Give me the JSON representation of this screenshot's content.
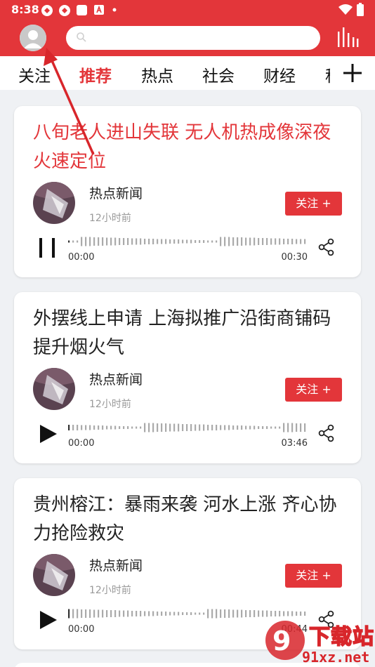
{
  "status_bar": {
    "time": "8:38"
  },
  "search": {
    "placeholder": ""
  },
  "tabs": [
    {
      "label": "关注",
      "active": false
    },
    {
      "label": "推荐",
      "active": true
    },
    {
      "label": "热点",
      "active": false
    },
    {
      "label": "社会",
      "active": false
    },
    {
      "label": "财经",
      "active": false
    },
    {
      "label": "科",
      "active": false
    }
  ],
  "cards": [
    {
      "title": "八旬老人进山失联 无人机热成像深夜火速定位",
      "title_highlighted": true,
      "source": "热点新闻",
      "time_ago": "12小时前",
      "follow_label": "关注 +",
      "state": "playing",
      "elapsed": "00:00",
      "duration": "00:30"
    },
    {
      "title": "外摆线上申请 上海拟推广沿街商铺码提升烟火气",
      "title_highlighted": false,
      "source": "热点新闻",
      "time_ago": "12小时前",
      "follow_label": "关注 +",
      "state": "paused",
      "elapsed": "00:00",
      "duration": "03:46"
    },
    {
      "title": "贵州榕江：暴雨来袭 河水上涨 齐心协力抢险救灾",
      "title_highlighted": false,
      "source": "热点新闻",
      "time_ago": "12小时前",
      "follow_label": "关注 +",
      "state": "paused",
      "elapsed": "00:00",
      "duration": "00:44"
    }
  ],
  "watermark": {
    "line1": "下载站",
    "line2": "91xz.net"
  },
  "colors": {
    "brand_red": "#e3363a",
    "background": "#eff1f4"
  },
  "icons": {
    "status": [
      "signal-app-icon",
      "signal-app-icon",
      "square-app-icon",
      "a-app-icon",
      "dot-icon",
      "wifi-icon",
      "battery-icon"
    ],
    "appbar": [
      "avatar-icon",
      "search-icon",
      "audio-bars-icon"
    ],
    "tabs": [
      "plus-icon"
    ],
    "card": [
      "pause-icon",
      "play-icon",
      "waveform-icon",
      "share-icon"
    ]
  }
}
